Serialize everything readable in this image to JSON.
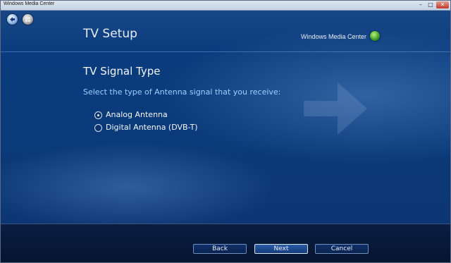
{
  "window": {
    "title": "Windows Media Center"
  },
  "titlebar": {
    "minimize": "–",
    "maximize": "□",
    "close": "✕"
  },
  "nav": {
    "back_icon": "back-arrow-icon",
    "home_icon": "windows-logo-icon"
  },
  "header": {
    "title": "TV Setup",
    "brand": "Windows Media Center"
  },
  "page": {
    "heading": "TV Signal Type",
    "prompt": "Select the type of Antenna signal that you receive:",
    "options": [
      {
        "label": "Analog Antenna",
        "selected": true
      },
      {
        "label": "Digital Antenna (DVB-T)",
        "selected": false
      }
    ]
  },
  "footer": {
    "back": "Back",
    "next": "Next",
    "cancel": "Cancel"
  },
  "colors": {
    "background": "#0b3a7a",
    "prompt": "#9fd0ff",
    "text": "#f2f6fb"
  }
}
